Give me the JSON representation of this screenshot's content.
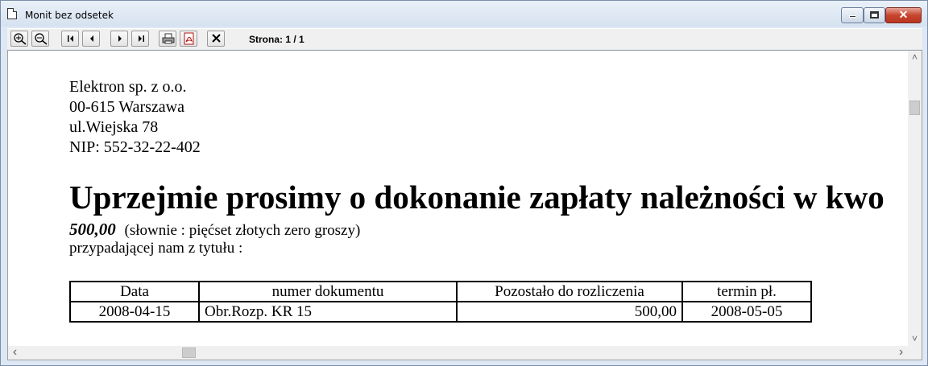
{
  "window": {
    "title": "Monit bez odsetek",
    "close_glyph": "✕"
  },
  "toolbar": {
    "buttons": [
      {
        "name": "zoom-in-icon"
      },
      {
        "name": "zoom-out-icon"
      },
      {
        "name": "first-page-icon"
      },
      {
        "name": "previous-page-icon"
      },
      {
        "name": "next-page-icon"
      },
      {
        "name": "last-page-icon"
      },
      {
        "name": "print-icon"
      },
      {
        "name": "export-pdf-icon"
      },
      {
        "name": "close-icon"
      }
    ],
    "page_counter": "Strona: 1 / 1"
  },
  "document": {
    "address": [
      "Elektron sp. z o.o.",
      "00-615 Warszawa",
      "ul.Wiejska 78",
      "NIP: 552-32-22-402"
    ],
    "headline": "Uprzejmie prosimy o dokonanie zapłaty należności w kwo",
    "amount": "500,00",
    "amount_words": "(słownie : pięćset złotych zero groszy)",
    "title_line": "przypadającej nam z tytułu :",
    "table": {
      "headers": [
        "Data",
        "numer dokumentu",
        "Pozostało do rozliczenia",
        "termin pł."
      ],
      "rows": [
        [
          "2008-04-15",
          "Obr.Rozp. KR 15",
          "500,00",
          "2008-05-05"
        ]
      ]
    }
  },
  "scrollbars": {
    "up_arrow": "˄",
    "down_arrow": "˅",
    "left_arrow": "‹",
    "right_arrow": "›"
  }
}
